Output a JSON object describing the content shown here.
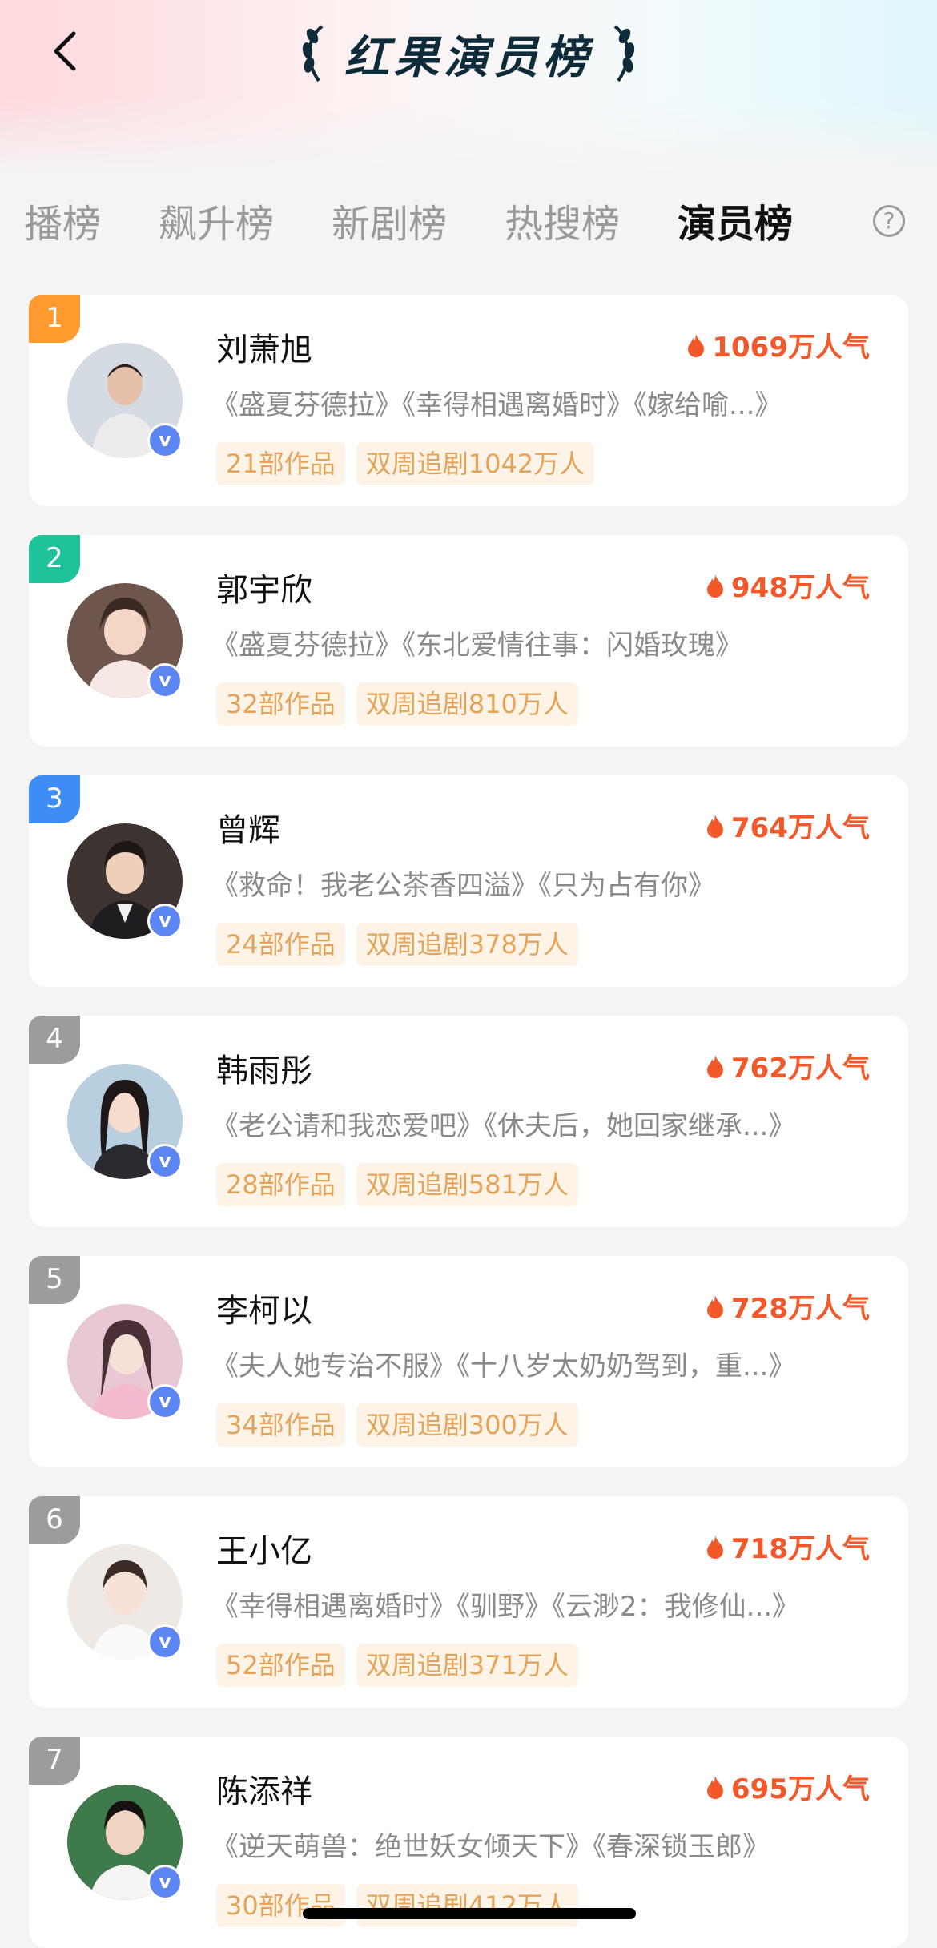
{
  "header": {
    "title": "红果演员榜"
  },
  "tabs": [
    {
      "label": "播榜",
      "active": false
    },
    {
      "label": "飙升榜",
      "active": false
    },
    {
      "label": "新剧榜",
      "active": false
    },
    {
      "label": "热搜榜",
      "active": false
    },
    {
      "label": "演员榜",
      "active": true
    }
  ],
  "help_glyph": "?",
  "verified_glyph": "v",
  "rank_colors": {
    "1": "#ff9a2e",
    "2": "#1fc39a",
    "3": "#3e8cf5",
    "other": "#9c9c9c"
  },
  "accent_color": "#f2582a",
  "actors": [
    {
      "rank": "1",
      "name": "刘萧旭",
      "popularity": "1069万人气",
      "works": "《盛夏芬德拉》《幸得相遇离婚时》《嫁给喻...》",
      "works_count": "21部作品",
      "followers": "双周追剧1042万人"
    },
    {
      "rank": "2",
      "name": "郭宇欣",
      "popularity": "948万人气",
      "works": "《盛夏芬德拉》《东北爱情往事：闪婚玫瑰》",
      "works_count": "32部作品",
      "followers": "双周追剧810万人"
    },
    {
      "rank": "3",
      "name": "曾辉",
      "popularity": "764万人气",
      "works": "《救命！我老公茶香四溢》《只为占有你》",
      "works_count": "24部作品",
      "followers": "双周追剧378万人"
    },
    {
      "rank": "4",
      "name": "韩雨彤",
      "popularity": "762万人气",
      "works": "《老公请和我恋爱吧》《休夫后，她回家继承...》",
      "works_count": "28部作品",
      "followers": "双周追剧581万人"
    },
    {
      "rank": "5",
      "name": "李柯以",
      "popularity": "728万人气",
      "works": "《夫人她专治不服》《十八岁太奶奶驾到，重...》",
      "works_count": "34部作品",
      "followers": "双周追剧300万人"
    },
    {
      "rank": "6",
      "name": "王小亿",
      "popularity": "718万人气",
      "works": "《幸得相遇离婚时》《驯野》《云渺2：我修仙...》",
      "works_count": "52部作品",
      "followers": "双周追剧371万人"
    },
    {
      "rank": "7",
      "name": "陈添祥",
      "popularity": "695万人气",
      "works": "《逆天萌兽：绝世妖女倾天下》《春深锁玉郎》",
      "works_count": "30部作品",
      "followers": "双周追剧412万人"
    }
  ]
}
